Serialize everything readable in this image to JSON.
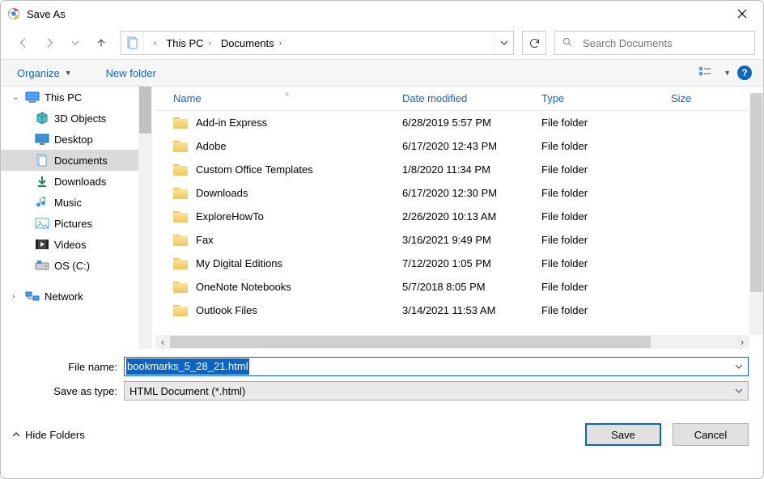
{
  "window": {
    "title": "Save As"
  },
  "breadcrumb": [
    {
      "label": "This PC"
    },
    {
      "label": "Documents"
    }
  ],
  "search_placeholder": "Search Documents",
  "toolbar": {
    "organize": "Organize",
    "new_folder": "New folder"
  },
  "tree": {
    "items": [
      {
        "label": "This PC",
        "icon": "pc",
        "caret": true,
        "indent": false,
        "selected": false
      },
      {
        "label": "3D Objects",
        "icon": "3d",
        "indent": true,
        "selected": false
      },
      {
        "label": "Desktop",
        "icon": "desktop",
        "indent": true,
        "selected": false
      },
      {
        "label": "Documents",
        "icon": "docs",
        "indent": true,
        "selected": true
      },
      {
        "label": "Downloads",
        "icon": "down",
        "indent": true,
        "selected": false
      },
      {
        "label": "Music",
        "icon": "music",
        "indent": true,
        "selected": false
      },
      {
        "label": "Pictures",
        "icon": "pics",
        "indent": true,
        "selected": false
      },
      {
        "label": "Videos",
        "icon": "video",
        "indent": true,
        "selected": false
      },
      {
        "label": "OS (C:)",
        "icon": "drive",
        "indent": true,
        "selected": false
      }
    ],
    "network": {
      "label": "Network",
      "icon": "net",
      "caret": true
    }
  },
  "columns": {
    "name": "Name",
    "date": "Date modified",
    "type": "Type",
    "size": "Size"
  },
  "rows": [
    {
      "name": "Add-in Express",
      "date": "6/28/2019 5:57 PM",
      "type": "File folder"
    },
    {
      "name": "Adobe",
      "date": "6/17/2020 12:43 PM",
      "type": "File folder"
    },
    {
      "name": "Custom Office Templates",
      "date": "1/8/2020 11:34 PM",
      "type": "File folder"
    },
    {
      "name": "Downloads",
      "date": "6/17/2020 12:30 PM",
      "type": "File folder"
    },
    {
      "name": "ExploreHowTo",
      "date": "2/26/2020 10:13 AM",
      "type": "File folder"
    },
    {
      "name": "Fax",
      "date": "3/16/2021 9:49 PM",
      "type": "File folder"
    },
    {
      "name": "My Digital Editions",
      "date": "7/12/2020 1:05 PM",
      "type": "File folder"
    },
    {
      "name": "OneNote Notebooks",
      "date": "5/7/2018 8:05 PM",
      "type": "File folder"
    },
    {
      "name": "Outlook Files",
      "date": "3/14/2021 11:53 AM",
      "type": "File folder"
    }
  ],
  "filename_label": "File name:",
  "saveastype_label": "Save as type:",
  "filename_value": "bookmarks_5_28_21.html",
  "saveastype_value": "HTML Document (*.html)",
  "hide_folders": "Hide Folders",
  "save_label": "Save",
  "cancel_label": "Cancel"
}
